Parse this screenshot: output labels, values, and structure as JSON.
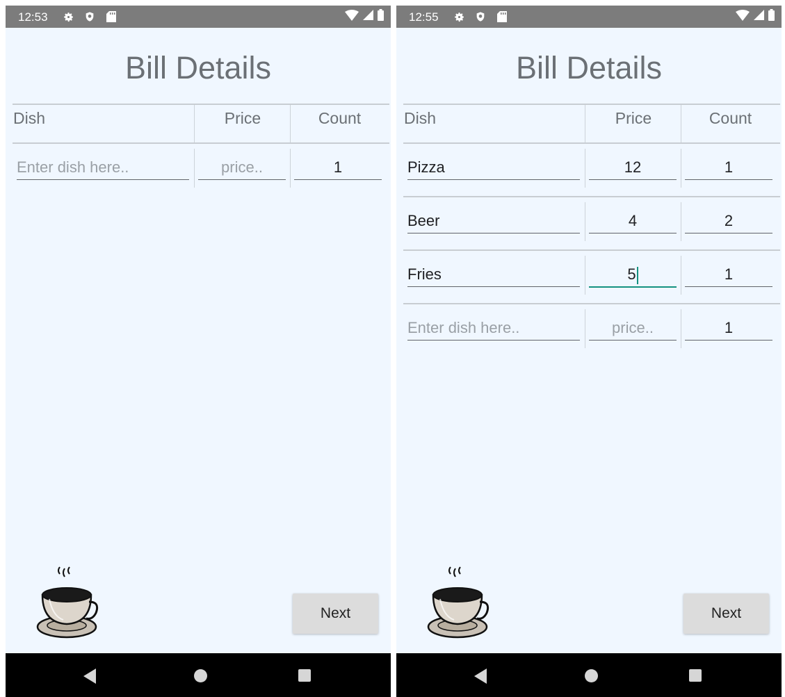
{
  "screens": [
    {
      "status": {
        "time": "12:53"
      },
      "title": "Bill Details",
      "headers": {
        "dish": "Dish",
        "price": "Price",
        "count": "Count"
      },
      "rows": [
        {
          "dish": "",
          "dish_placeholder": "Enter dish here..",
          "price": "",
          "price_placeholder": "price..",
          "count": "1",
          "focused": false
        }
      ],
      "next_label": "Next"
    },
    {
      "status": {
        "time": "12:55"
      },
      "title": "Bill Details",
      "headers": {
        "dish": "Dish",
        "price": "Price",
        "count": "Count"
      },
      "rows": [
        {
          "dish": "Pizza",
          "dish_placeholder": "",
          "price": "12",
          "price_placeholder": "",
          "count": "1",
          "focused": false
        },
        {
          "dish": "Beer",
          "dish_placeholder": "",
          "price": "4",
          "price_placeholder": "",
          "count": "2",
          "focused": false
        },
        {
          "dish": "Fries",
          "dish_placeholder": "",
          "price": "5",
          "price_placeholder": "",
          "count": "1",
          "focused": true
        },
        {
          "dish": "",
          "dish_placeholder": "Enter dish here..",
          "price": "",
          "price_placeholder": "price..",
          "count": "1",
          "focused": false
        }
      ],
      "next_label": "Next"
    }
  ],
  "icons": {
    "status": [
      "settings-icon",
      "shield-icon",
      "sd-card-icon",
      "wifi-icon",
      "signal-icon",
      "battery-icon"
    ],
    "app": "coffee-cup-icon",
    "nav": [
      "back-icon",
      "home-icon",
      "recents-icon"
    ]
  },
  "colors": {
    "background": "#f0f7ff",
    "statusbar": "#7c7c7c",
    "title": "#6b7075",
    "focus_accent": "#149280",
    "button": "#dcdcdc",
    "navbar": "#000000"
  }
}
